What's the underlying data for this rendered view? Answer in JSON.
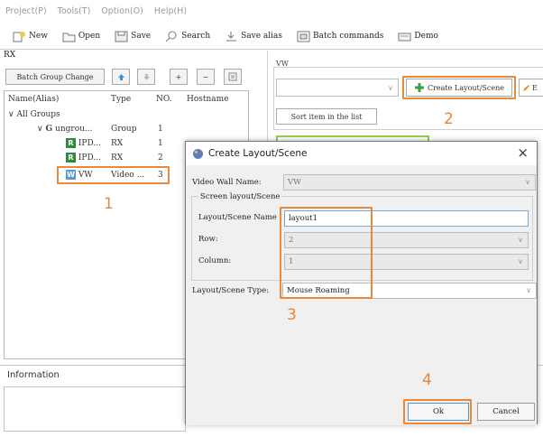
{
  "menu": [
    "Project(P)",
    "Tools(T)",
    "Option(O)",
    "Help(H)"
  ],
  "toolbar": {
    "new": "New",
    "open": "Open",
    "save": "Save",
    "search": "Search",
    "save_alias": "Save alias",
    "batch_commands": "Batch commands",
    "demo": "Demo"
  },
  "left_panel": {
    "title": "RX",
    "batch_group_change": "Batch Group Change",
    "plus": "+",
    "minus": "−",
    "columns": [
      "Name(Alias)",
      "Type",
      "NO.",
      "Hostname"
    ],
    "tree": {
      "all_groups": "All Groups",
      "group_badge": "G",
      "group_name": "ungrou...",
      "group_type": "Group",
      "group_no": "1",
      "rx1_badge": "R",
      "rx1_name": "IPD...",
      "rx1_type": "RX",
      "rx1_no": "1",
      "rx2_badge": "R",
      "rx2_name": "IPD...",
      "rx2_type": "RX",
      "rx2_no": "2",
      "vw_badge": "W",
      "vw_name": "VW",
      "vw_type": "Video ...",
      "vw_no": "3"
    }
  },
  "right_panel": {
    "title": "VW",
    "create_layout": "Create Layout/Scene",
    "edit_cut": "E",
    "sort_item": "Sort item in the list"
  },
  "information": {
    "title": "Information"
  },
  "dialog": {
    "title": "Create Layout/Scene",
    "close": "×",
    "video_wall_name_label": "Video Wall Name:",
    "video_wall_name_value": "VW",
    "screen_layout_group": "Screen layout/Scene",
    "layout_name_label": "Layout/Scene Name",
    "layout_name_value": "layout1",
    "row_label": "Row:",
    "row_value": "2",
    "column_label": "Column:",
    "column_value": "1",
    "layout_type_label": "Layout/Scene Type:",
    "layout_type_value": "Mouse Roaming",
    "ok": "Ok",
    "cancel": "Cancel"
  },
  "annotations": {
    "n1": "1",
    "n2": "2",
    "n3": "3",
    "n4": "4"
  },
  "colors": {
    "highlight": "#e98a3a",
    "rx_badge": "#2e8b3c",
    "vw_badge": "#5b9bd5",
    "group_badge": "#4a4a4a"
  }
}
